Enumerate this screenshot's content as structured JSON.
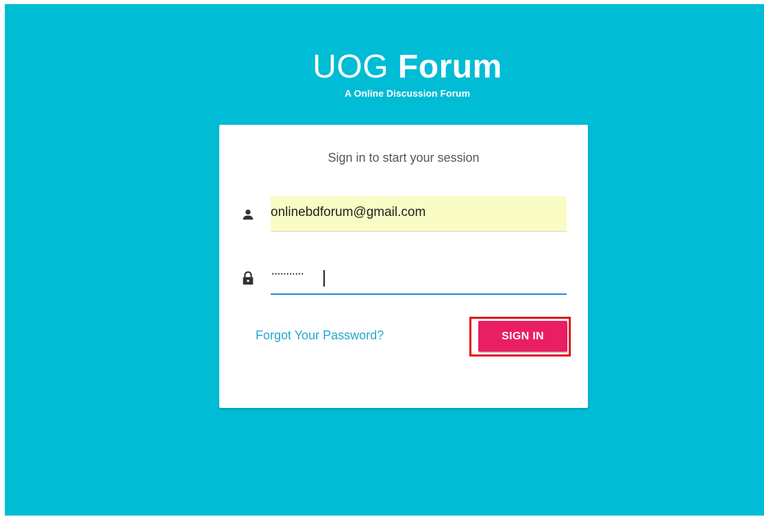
{
  "brand": {
    "title_light": "UOG",
    "title_bold": "Forum",
    "subtitle": "A Online Discussion Forum"
  },
  "login_card": {
    "message": "Sign in to start your session",
    "email": {
      "value": "onlinebdforum@gmail.com",
      "icon": "person-icon"
    },
    "password": {
      "masked_value": "···········",
      "icon": "lock-icon"
    },
    "forgot_link": "Forgot Your Password?",
    "signin_label": "SIGN IN"
  },
  "colors": {
    "page_background": "#00bcd4",
    "card_background": "#ffffff",
    "autofill_background": "#fafcc5",
    "focus_underline": "#1e88e5",
    "link": "#26a6d2",
    "button": "#e91e63",
    "highlight_outline": "#e30613"
  }
}
